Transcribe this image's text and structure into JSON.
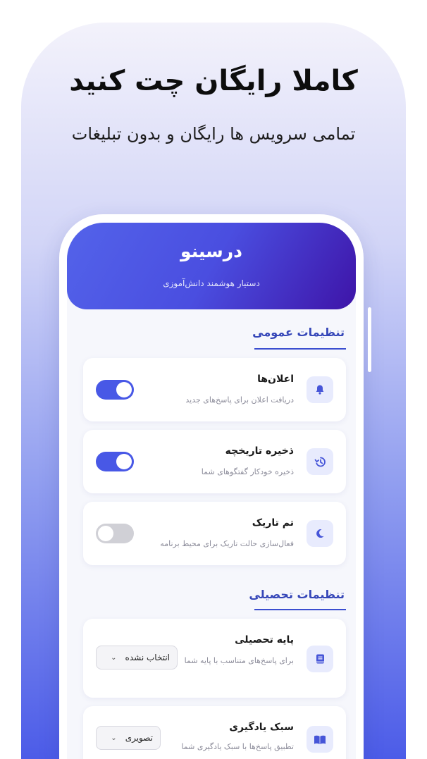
{
  "promo": {
    "headline": "کاملا رایگان چت کنید",
    "subline": "تمامی سرویس ها رایگان و بدون تبلیغات"
  },
  "app": {
    "title": "درسینو",
    "subtitle": "دستیار هوشمند دانش‌آموزی"
  },
  "sections": {
    "general": "تنظیمات عمومی",
    "academic": "تنظیمات تحصیلی"
  },
  "settings": {
    "notifications": {
      "title": "اعلان‌ها",
      "desc": "دریافت اعلان برای پاسخ‌های جدید",
      "enabled": true,
      "icon": "bell-icon"
    },
    "history": {
      "title": "ذخیره تاریخچه",
      "desc": "ذخیره خودکار گفتگوهای شما",
      "enabled": true,
      "icon": "history-icon"
    },
    "dark": {
      "title": "تم تاریک",
      "desc": "فعال‌سازی حالت تاریک برای محیط برنامه",
      "enabled": false,
      "icon": "moon-icon"
    },
    "grade": {
      "title": "پایه تحصیلی",
      "desc": "برای پاسخ‌های متناسب با پایه شما",
      "value": "انتخاب نشده",
      "icon": "book-icon"
    },
    "style": {
      "title": "سبک یادگیری",
      "desc": "تطبیق پاسخ‌ها با سبک یادگیری شما",
      "value": "تصویری",
      "icon": "open-book-icon"
    }
  },
  "colors": {
    "accent": "#4858e6",
    "section_title": "#3546b8"
  }
}
